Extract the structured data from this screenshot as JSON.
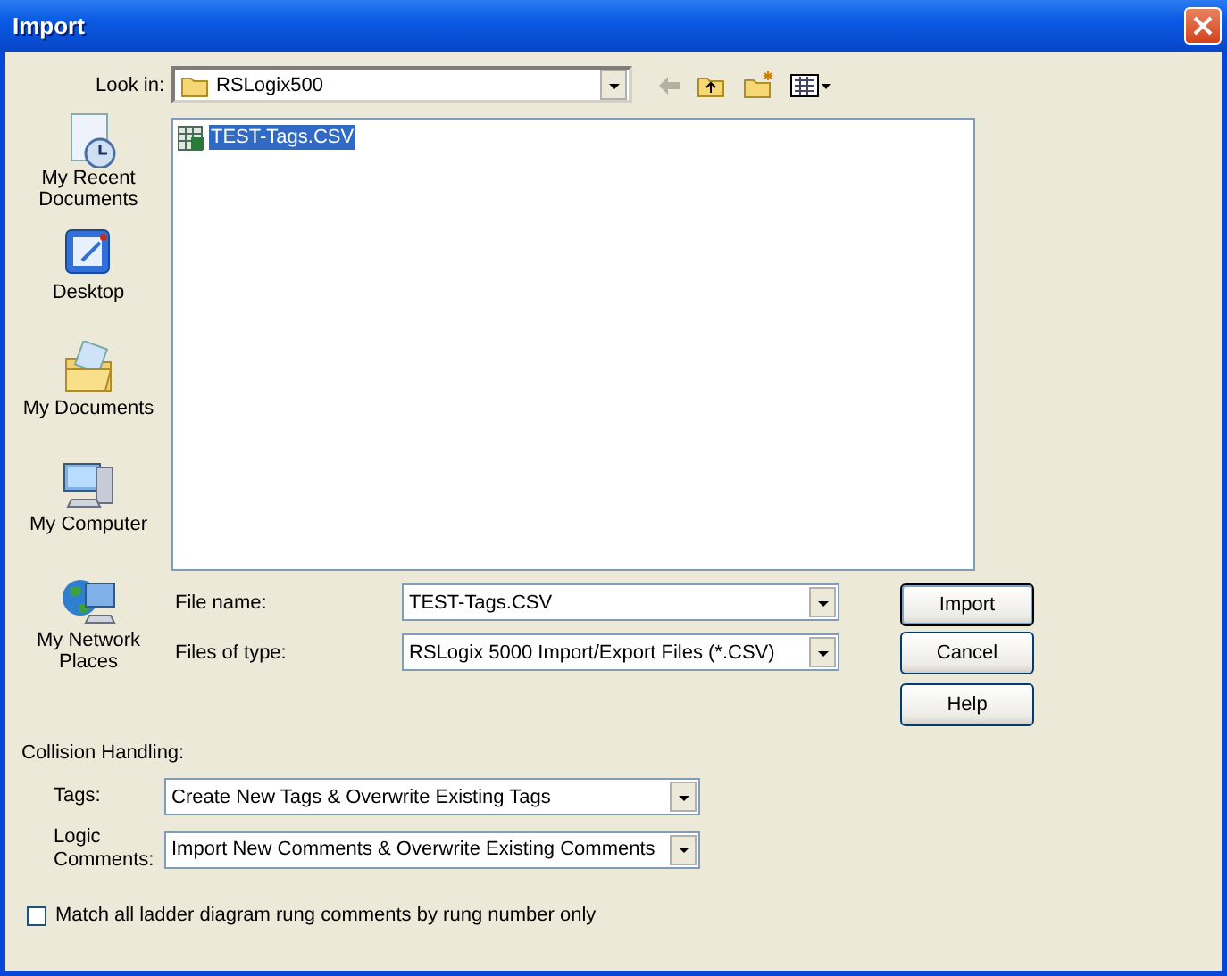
{
  "window": {
    "title": "Import"
  },
  "look_in": {
    "label": "Look in:",
    "value": "RSLogix500"
  },
  "places": [
    {
      "label": "My Recent Documents",
      "kind": "recent"
    },
    {
      "label": "Desktop",
      "kind": "desktop"
    },
    {
      "label": "My Documents",
      "kind": "documents"
    },
    {
      "label": "My Computer",
      "kind": "computer"
    },
    {
      "label": "My Network Places",
      "kind": "network"
    }
  ],
  "files": [
    {
      "name": "TEST-Tags.CSV",
      "selected": true
    }
  ],
  "file_name": {
    "label": "File name:",
    "value": "TEST-Tags.CSV"
  },
  "file_type": {
    "label": "Files of type:",
    "value": "RSLogix 5000 Import/Export Files (*.CSV)"
  },
  "buttons": [
    {
      "label": "Import",
      "default": true
    },
    {
      "label": "Cancel",
      "default": false
    },
    {
      "label": "Help",
      "default": false
    }
  ],
  "collision": {
    "title": "Collision Handling:",
    "tags": {
      "label": "Tags:",
      "value": "Create New Tags & Overwrite Existing Tags"
    },
    "comments": {
      "label": "Logic Comments:",
      "value": "Import New Comments & Overwrite Existing Comments"
    }
  },
  "option": {
    "label": "Match all ladder diagram rung comments by rung number only",
    "checked": false
  }
}
